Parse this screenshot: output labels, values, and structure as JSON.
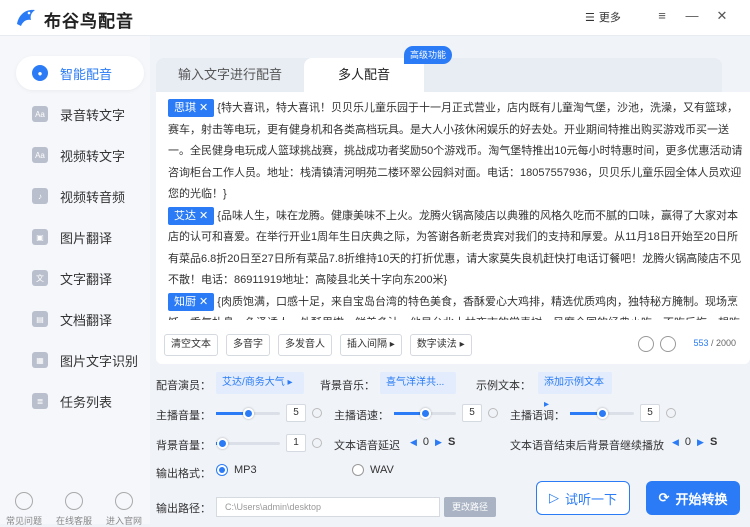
{
  "app": {
    "title": "布谷鸟配音",
    "more_label": "更多"
  },
  "sidebar": {
    "items": [
      {
        "label": "智能配音",
        "active": true
      },
      {
        "label": "录音转文字"
      },
      {
        "label": "视频转文字"
      },
      {
        "label": "视频转音频"
      },
      {
        "label": "图片翻译"
      },
      {
        "label": "文字翻译"
      },
      {
        "label": "文档翻译"
      },
      {
        "label": "图片文字识别"
      },
      {
        "label": "任务列表"
      }
    ],
    "footer": [
      {
        "label": "常见问题"
      },
      {
        "label": "在线客服"
      },
      {
        "label": "进入官网"
      }
    ]
  },
  "tabs": {
    "input_text": "输入文字进行配音",
    "multi_voice": "多人配音",
    "badge": "高级功能"
  },
  "editor": {
    "segments": [
      {
        "speaker": "思琪",
        "text": "{特大喜讯，特大喜讯！贝贝乐儿童乐园于十一月正式营业，店内既有儿童淘气堡，沙池，洗澡，又有篮球，赛车，射击等电玩，更有健身机和各类高档玩具。是大人小孩休闲娱乐的好去处。开业期间特推出购买游戏币买一送一。全民健身电玩成人篮球挑战赛，挑战成功者奖励50个游戏币。淘气堡特推出10元每小时特惠时间，更多优惠活动请咨询柜台工作人员。地址：栈清镇清河明苑二楼环翠公园斜对面。电话：18057557936，贝贝乐儿童乐园全体人员欢迎您的光临！}"
      },
      {
        "speaker": "艾达",
        "text": "{品味人生，味在龙腾。健康美味不上火。龙腾火锅高陵店以典雅的风格久吃而不腻的口味，赢得了大家对本店的认可和喜爱。在举行开业1周年生日庆典之际，为答谢各新老贵宾对我们的支持和厚爱。从11月18日开始至20日所有菜品6.8折20日至27日所有菜品7.8折维持10天的打折优惠，请大家莫失良机赶快打电话订餐吧！龙腾火锅高陵店不见不散！电话：86911919地址：高陵县北关十字向东200米}"
      },
      {
        "speaker": "知厨",
        "text": "{肉质饱满，口感十足，来自宝岛台湾的特色美食，香酥爱心大鸡排，精选优质鸡肉，独特秘方腌制。现场烹饪，香气扑鼻、色泽诱人、外酥里嫩、鲜美多汁。他是台北士林夜市的常青树，风靡全国的经典小吃，不吃后悔。想吃肯德"
      }
    ],
    "toolbar": [
      "清空文本",
      "多音字",
      "多发音人",
      "插入间隔 ▸",
      "数字读法 ▸"
    ],
    "char_count": "553",
    "char_max": " / 2000"
  },
  "settings": {
    "voice_label": "配音演员：",
    "voice_value": "艾达/商务大气",
    "bgm_label": "背景音乐：",
    "bgm_value": "喜气洋洋共...",
    "sample_label": "示例文本：",
    "sample_value": "添加示例文本",
    "volume_label": "主播音量：",
    "volume_value": "5",
    "volume_level": 0.5,
    "speed_label": "主播语速：",
    "speed_value": "5",
    "speed_level": 0.5,
    "tone_label": "主播语调：",
    "tone_value": "5",
    "tone_level": 0.5,
    "bg_volume_label": "背景音量：",
    "bg_volume_value": "1",
    "bg_volume_level": 0.1,
    "delay_label": "文本语音延迟",
    "delay_value": "0",
    "delay_unit": "S",
    "continue_label": "文本语音结束后背景音继续播放",
    "continue_value": "0",
    "continue_unit": "S",
    "format_label": "输出格式：",
    "format_mp3": "MP3",
    "format_wav": "WAV",
    "path_label": "输出路径：",
    "path_value": "C:\\Users\\admin\\desktop",
    "path_button": "更改路径"
  },
  "actions": {
    "listen": "试听一下",
    "start": "开始转换"
  },
  "colors": {
    "accent": "#2a7bf5"
  }
}
